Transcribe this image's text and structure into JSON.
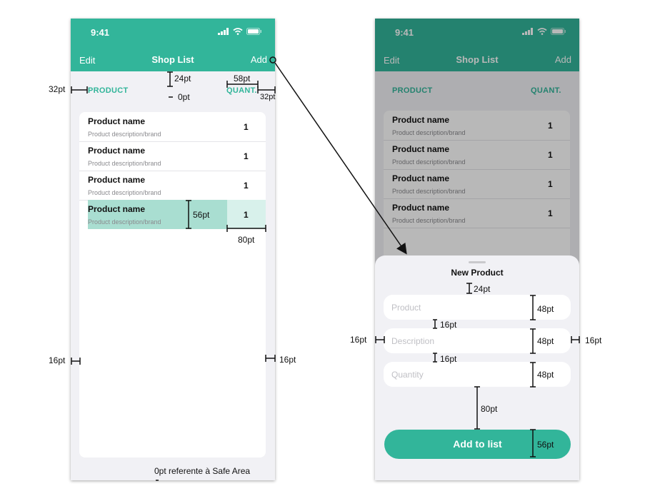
{
  "status_bar": {
    "time": "9:41"
  },
  "left_screen": {
    "nav": {
      "left": "Edit",
      "title": "Shop List",
      "right": "Add"
    },
    "columns": {
      "product": "PRODUCT",
      "quantity": "QUANT."
    },
    "rows": [
      {
        "name": "Product name",
        "description": "Product description/brand",
        "qty": "1"
      },
      {
        "name": "Product name",
        "description": "Product description/brand",
        "qty": "1"
      },
      {
        "name": "Product name",
        "description": "Product description/brand",
        "qty": "1"
      },
      {
        "name": "Product name",
        "description": "Product description/brand",
        "qty": "1"
      }
    ]
  },
  "right_screen": {
    "nav": {
      "left": "Edit",
      "title": "Shop List",
      "right": "Add"
    },
    "columns": {
      "product": "PRODUCT",
      "quantity": "QUANT."
    },
    "rows": [
      {
        "name": "Product name",
        "description": "Product description/brand",
        "qty": "1"
      },
      {
        "name": "Product name",
        "description": "Product description/brand",
        "qty": "1"
      },
      {
        "name": "Product name",
        "description": "Product description/brand",
        "qty": "1"
      },
      {
        "name": "Product name",
        "description": "Product description/brand",
        "qty": "1"
      }
    ],
    "sheet": {
      "title": "New Product",
      "product_placeholder": "Product",
      "description_placeholder": "Description",
      "quantity_placeholder": "Quantity",
      "button": "Add to list"
    }
  },
  "annotations": {
    "a_32pt": "32pt",
    "a_24pt": "24pt",
    "a_0pt": "0pt",
    "a_58pt": "58pt",
    "a_32pt_right": "32pt",
    "a_56pt": "56pt",
    "a_80pt": "80pt",
    "a_16pt_left": "16pt",
    "a_16pt_right": "16pt",
    "a_safe_area": "0pt referente à Safe Area",
    "b_24pt": "24pt",
    "b_48pt_1": "48pt",
    "b_16pt_1": "16pt",
    "b_16pt_left": "16pt",
    "b_48pt_2": "48pt",
    "b_16pt_right": "16pt",
    "b_16pt_2": "16pt",
    "b_48pt_3": "48pt",
    "b_80pt": "80pt",
    "b_56pt": "56pt"
  },
  "colors": {
    "accent": "#32b59a",
    "highlight_row": "#a9ded1",
    "highlight_qty": "#d8f1eb",
    "background": "#f1f1f5"
  },
  "icons": [
    "signal-icon",
    "wifi-icon",
    "battery-icon"
  ]
}
